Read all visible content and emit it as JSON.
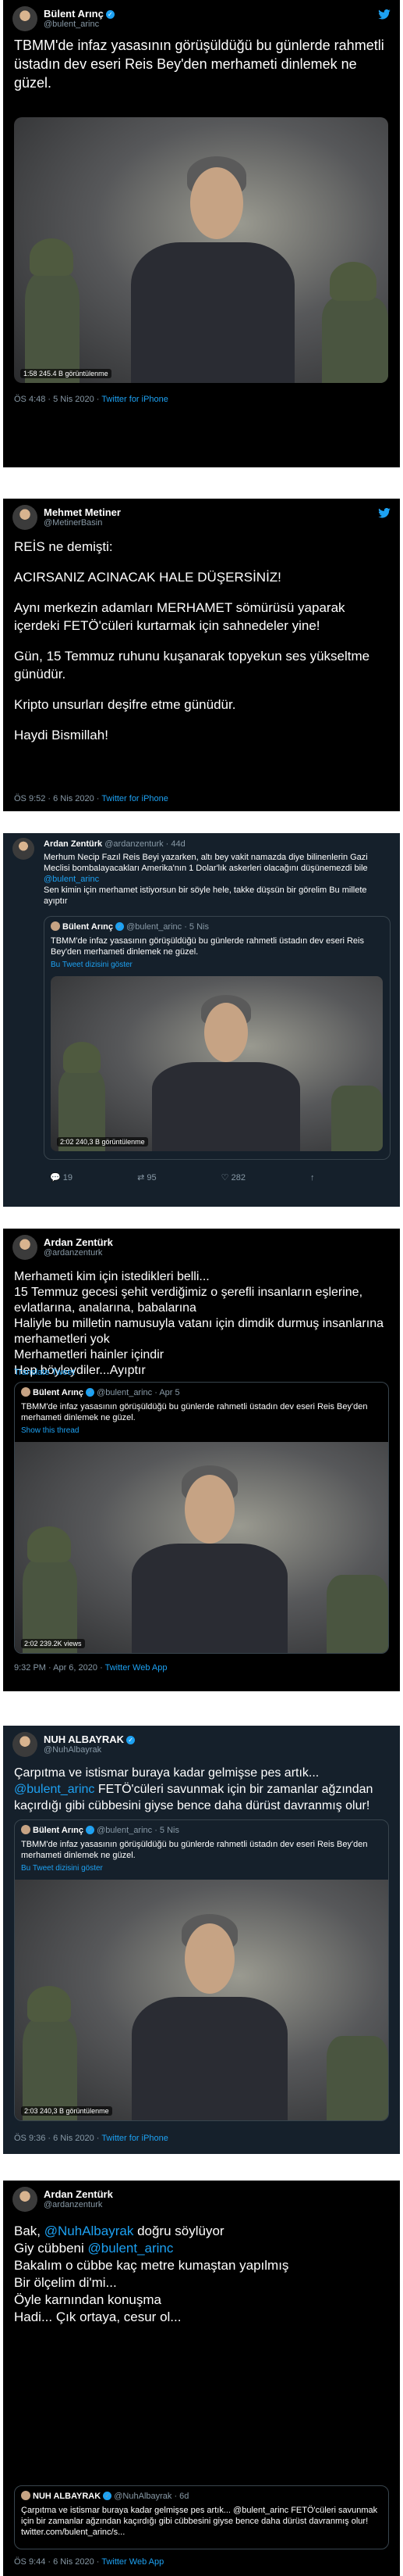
{
  "tweet1": {
    "name": "Bülent Arınç",
    "handle": "@bulent_arinc",
    "text": "TBMM'de infaz yasasının görüşüldüğü bu günlerde rahmetli üstadın dev eseri Reis Bey'den merhameti dinlemek ne güzel.",
    "video_info": "1:58  245.4 B görüntülenme",
    "time": "ÖS 4:48 · 5 Nis 2020 · ",
    "source": "Twitter for iPhone"
  },
  "tweet2": {
    "name": "Mehmet Metiner",
    "handle": "@MetinerBasin",
    "paragraphs": [
      "REİS ne demişti:",
      "ACIRSANIZ ACINACAK HALE DÜŞERSİNİZ!",
      "Aynı merkezin adamları MERHAMET sömürüsü yaparak içerdeki FETÖ'cüleri kurtarmak için sahnedeler yine!",
      "Gün, 15 Temmuz ruhunu kuşanarak topyekun ses yükseltme günüdür.",
      "Kripto unsurları deşifre etme günüdür.",
      "Haydi Bismillah!"
    ],
    "time": "ÖS 9:52 · 6 Nis 2020 · ",
    "source": "Twitter for iPhone"
  },
  "tweet3": {
    "name": "Ardan Zentürk",
    "handle": "@ardanzenturk · 44d",
    "text": "Merhum Necip Fazıl Reis Beyi yazarken, altı bey vakit namazda diye bilinenlerin Gazi Meclisi bombalayacakları Amerika'nın 1 Dolar'lık askerleri olacağını düşünemezdi bile",
    "mention": "@bulent_arinc",
    "text2": "Sen kimin için merhamet istiyorsun bir söyle hele, takke düşsün bir görelim Bu millete ayıptır",
    "quote_name": "Bülent Arınç",
    "quote_handle": "@bulent_arinc · 5 Nis",
    "quote_text": "TBMM'de infaz yasasının görüşüldüğü bu günlerde rahmetli üstadın dev eseri Reis Bey'den merhameti dinlemek ne güzel.",
    "quote_link": "Bu Tweet dizisini göster",
    "video_info": "2:02   240,3 B görüntülenme",
    "replies": "19",
    "retweets": "95",
    "likes": "282"
  },
  "tweet4": {
    "name": "Ardan Zentürk",
    "handle": "@ardanzenturk",
    "lines": [
      "Merhameti kim için istedikleri belli...",
      "15 Temmuz gecesi şehit verdiğimiz o şerefli insanların eşlerine, evlatlarına, analarına, babalarına",
      "Haliyle bu milletin namusuyla vatanı için dimdik durmuş insanlarına merhametleri yok",
      "Merhametleri hainler içindir",
      "Hep böyleydiler...Ayıptır"
    ],
    "translate": "Translate Tweet",
    "quote_name": "Bülent Arınç",
    "quote_handle": "@bulent_arinc · Apr 5",
    "quote_text": "TBMM'de infaz yasasının görüşüldüğü bu günlerde rahmetli üstadın dev eseri Reis Bey'den merhameti dinlemek ne güzel.",
    "quote_link": "Show this thread",
    "video_info": "2:02   239.2K views",
    "time": "9:32 PM · Apr 6, 2020 · ",
    "source": "Twitter Web App"
  },
  "tweet5": {
    "name": "NUH ALBAYRAK",
    "handle": "@NuhAlbayrak",
    "text_a": "Çarpıtma ve istismar buraya kadar gelmişse pes artık...",
    "mention": "@bulent_arinc",
    "text_b": " FETÖ'cüleri savunmak için bir zamanlar ağzından kaçırdığı gibi cübbesini giyse bence daha dürüst davranmış olur!",
    "quote_name": "Bülent Arınç",
    "quote_handle": "@bulent_arinc · 5 Nis",
    "quote_text": "TBMM'de infaz yasasının görüşüldüğü bu günlerde rahmetli üstadın dev eseri Reis Bey'den merhameti dinlemek ne güzel.",
    "quote_link": "Bu Tweet dizisini göster",
    "video_info": "2:03   240,3 B görüntülenme",
    "time": "ÖS 9:36 · 6 Nis 2020 · ",
    "source": "Twitter for iPhone"
  },
  "tweet6": {
    "name": "Ardan Zentürk",
    "handle": "@ardanzenturk",
    "line1_a": "Bak, ",
    "line1_mention": "@NuhAlbayrak",
    "line1_b": " doğru söylüyor",
    "line2_a": "Giy cübbeni ",
    "line2_mention": "@bulent_arinc",
    "line3": "Bakalım o cübbe kaç metre kumaştan yapılmış",
    "line4": "Bir ölçelim di'mi...",
    "line5": "Öyle karnından konuşma",
    "line6": "Hadi... Çık ortaya, cesur ol...",
    "quote_name": "NUH ALBAYRAK",
    "quote_handle": "@NuhAlbayrak · 6d",
    "quote_text": "Çarpıtma ve istismar buraya kadar gelmişse pes artık... @bulent_arinc FETÖ'cüleri savunmak için bir zamanlar ağzından kaçırdığı gibi cübbesini giyse bence daha dürüst davranmış olur! twitter.com/bulent_arinc/s...",
    "time": "ÖS 9:44 · 6 Nis 2020 · ",
    "source": "Twitter Web App"
  }
}
